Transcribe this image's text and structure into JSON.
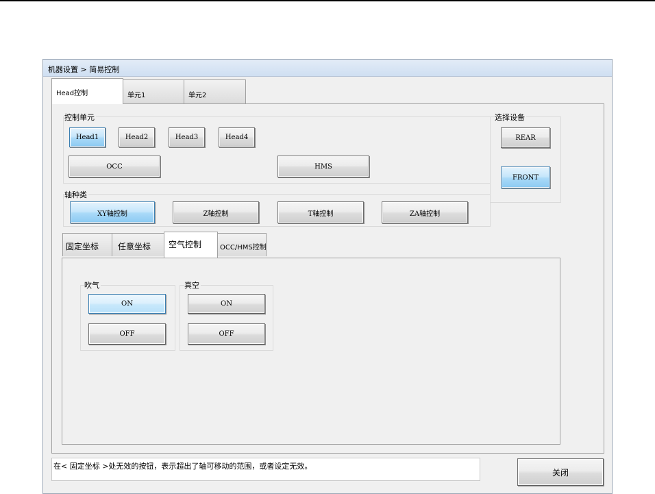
{
  "window": {
    "title": "机器设置 > 简易控制"
  },
  "main_tabs": [
    {
      "label": "Head控制"
    },
    {
      "label": "单元1"
    },
    {
      "label": "单元2"
    }
  ],
  "control_unit": {
    "label": "控制单元",
    "heads": [
      "Head1",
      "Head2",
      "Head3",
      "Head4"
    ],
    "occ": "OCC",
    "hms": "HMS"
  },
  "axis_type": {
    "label": "轴种类",
    "buttons": [
      "XY轴控制",
      "Z轴控制",
      "T轴控制",
      "ZA轴控制"
    ]
  },
  "device": {
    "label": "选择设备",
    "rear": "REAR",
    "front": "FRONT"
  },
  "sub_tabs": [
    {
      "label": "固定坐标"
    },
    {
      "label": "任意坐标"
    },
    {
      "label": "空气控制"
    },
    {
      "label": "OCC/HMS控制"
    }
  ],
  "air": {
    "blow": {
      "label": "吹气",
      "on": "ON",
      "off": "OFF"
    },
    "vacuum": {
      "label": "真空",
      "on": "ON",
      "off": "OFF"
    }
  },
  "status_message": "在< 固定坐标 >处无效的按钮，表示超出了轴可移动的范围，或者设定无效。",
  "close_button": "关闭"
}
